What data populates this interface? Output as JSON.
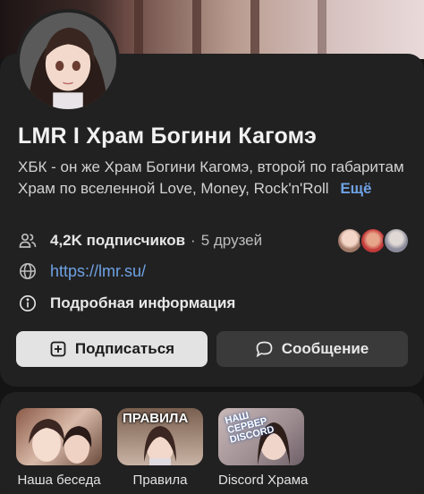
{
  "community": {
    "name": "LMR I Храм Богини Кагомэ",
    "description": "ХБК - он же Храм Богини Кагомэ, второй по габаритам Храм по вселенной Love, Money, Rock'n'Roll",
    "more_label": "Ещё",
    "subscribers": "4,2K подписчиков",
    "friends_separator": "·",
    "friends": "5 друзей",
    "link": "https://lmr.su/",
    "details_label": "Подробная информация"
  },
  "actions": {
    "subscribe_label": "Подписаться",
    "message_label": "Сообщение"
  },
  "stories": [
    {
      "caption": "Наша беседа",
      "overlay": ""
    },
    {
      "caption": "Правила",
      "overlay": "ПРАВИЛА"
    },
    {
      "caption": "Discord Храма",
      "overlay": "НАШ СЕРВЕР DISCORD"
    }
  ],
  "colors": {
    "background": "#141414",
    "card": "#212121",
    "link": "#6fa2e4",
    "subscribe_button": "#e3e3e3",
    "message_button": "#3a3a3a"
  },
  "icons": [
    "people-icon",
    "globe-icon",
    "info-icon",
    "plus-square-icon",
    "chat-bubble-icon"
  ]
}
